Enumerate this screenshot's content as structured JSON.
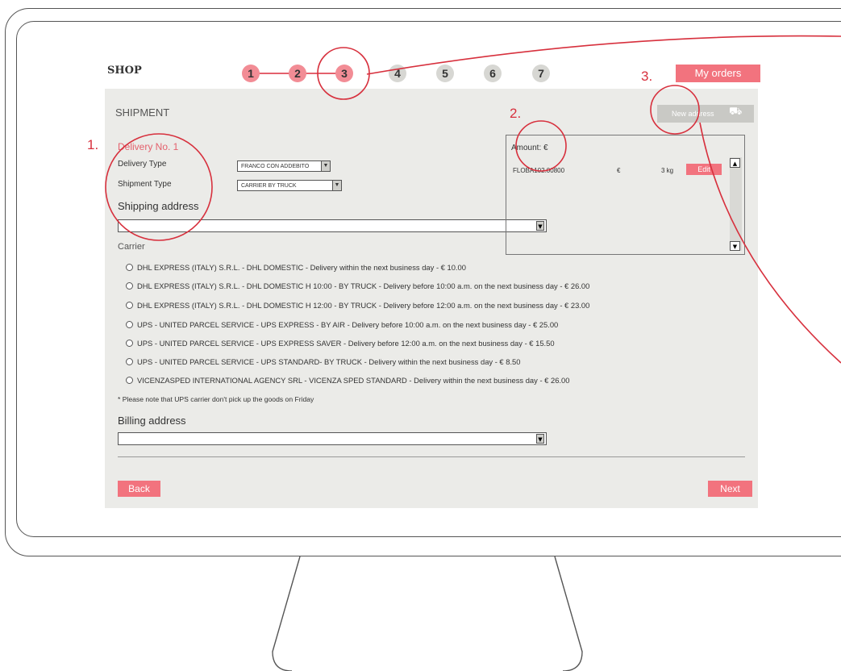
{
  "header": {
    "shop_label": "SHOP",
    "steps": [
      "1",
      "2",
      "3",
      "4",
      "5",
      "6",
      "7"
    ],
    "current_step": 3,
    "my_orders_label": "My orders"
  },
  "annotations": [
    "1.",
    "2.",
    "3."
  ],
  "page": {
    "title": "SHIPMENT",
    "new_address_label": "New address"
  },
  "delivery": {
    "heading": "Delivery No. 1",
    "delivery_type_label": "Delivery Type",
    "delivery_type_value": "FRANCO CON ADDEBITO",
    "shipment_type_label": "Shipment Type",
    "shipment_type_value": "CARRIER BY TRUCK",
    "shipping_address_label": "Shipping address",
    "shipping_address_value": ""
  },
  "amount_panel": {
    "label": "Amount: €",
    "product_code": "FLOBA102.00800",
    "currency": "€",
    "weight": "3 kg",
    "edit_label": "Edit"
  },
  "carrier": {
    "label": "Carrier",
    "options": [
      "DHL EXPRESS (ITALY) S.R.L. - DHL DOMESTIC - Delivery within the next business day - € 10.00",
      "DHL EXPRESS (ITALY) S.R.L. - DHL DOMESTIC H 10:00 - BY TRUCK - Delivery before 10:00 a.m. on the next business day - € 26.00",
      "DHL EXPRESS (ITALY) S.R.L. - DHL DOMESTIC H 12:00 - BY TRUCK - Delivery before 12:00 a.m. on the next business day - € 23.00",
      "UPS - UNITED PARCEL SERVICE - UPS EXPRESS - BY AIR - Delivery before 10:00 a.m. on the next business day - € 25.00",
      "UPS - UNITED PARCEL SERVICE - UPS EXPRESS SAVER - Delivery before 12:00 a.m. on the next business day - € 15.50",
      "UPS - UNITED PARCEL SERVICE - UPS STANDARD- BY TRUCK - Delivery within the next business day - € 8.50",
      "VICENZASPED INTERNATIONAL AGENCY SRL - VICENZA SPED STANDARD - Delivery within the next business day - € 26.00"
    ],
    "note": "* Please note that UPS carrier don't pick up the goods on Friday"
  },
  "billing": {
    "label": "Billing address",
    "value": ""
  },
  "footer": {
    "back_label": "Back",
    "next_label": "Next"
  },
  "colors": {
    "accent": "#f2737e",
    "annotation": "#d7303d",
    "panel_bg": "#ebebe8"
  }
}
